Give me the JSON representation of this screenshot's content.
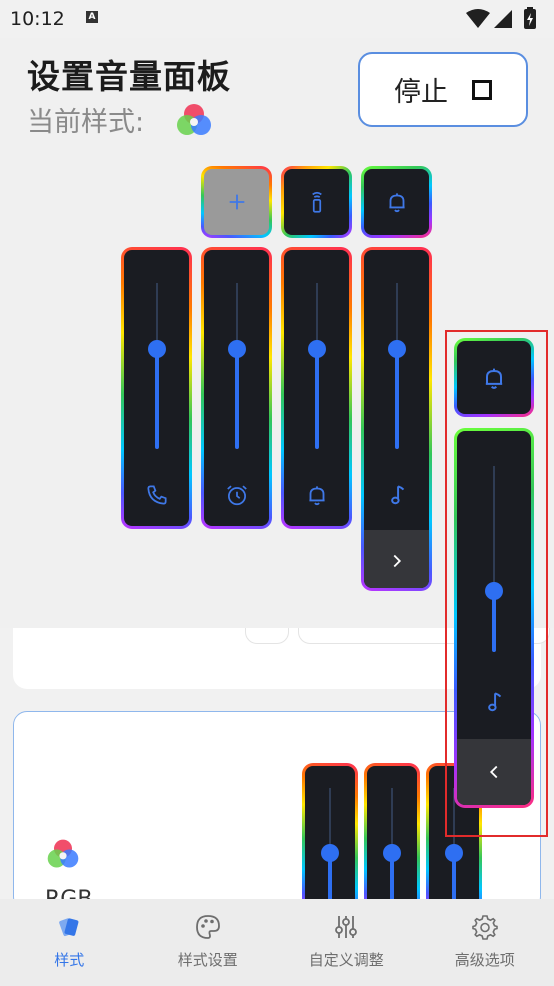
{
  "status_bar": {
    "time": "10:12",
    "notification_badge": "A",
    "icons": [
      "wifi-icon",
      "signal-icon",
      "battery-charging-icon"
    ]
  },
  "header": {
    "title": "设置音量面板",
    "style_label": "当前样式:",
    "stop_button_label": "停止"
  },
  "panel": {
    "style": "rgb-border",
    "colors": {
      "accent": "#2e6ff2",
      "panel_bg": "#1a1c22",
      "expand_bg": "#35363a",
      "red_frame": "#e22b2b"
    },
    "top_buttons": [
      {
        "icon": "plus-icon"
      },
      {
        "icon": "remote-icon"
      },
      {
        "icon": "bell-icon"
      }
    ],
    "sliders": [
      {
        "icon": "phone-icon",
        "level": 0.6
      },
      {
        "icon": "alarm-icon",
        "level": 0.6
      },
      {
        "icon": "bell-icon",
        "level": 0.6
      },
      {
        "icon": "music-note-icon",
        "level": 0.6
      }
    ],
    "expand_icon": "chevron-right-icon"
  },
  "side_panel": {
    "top_button_icon": "bell-icon",
    "slider": {
      "icon": "music-note-icon",
      "level": 0.33
    },
    "collapse_icon": "chevron-left-icon"
  },
  "preview_card": {
    "label_partial": "RGB",
    "sliders": [
      {
        "level": 0.5
      },
      {
        "level": 0.5
      },
      {
        "level": 0.5
      }
    ]
  },
  "bottom_nav": {
    "items": [
      {
        "label": "样式",
        "icon": "style-icon",
        "active": true
      },
      {
        "label": "样式设置",
        "icon": "palette-icon",
        "active": false
      },
      {
        "label": "自定义调整",
        "icon": "sliders-icon",
        "active": false
      },
      {
        "label": "高级选项",
        "icon": "gear-icon",
        "active": false
      }
    ]
  }
}
